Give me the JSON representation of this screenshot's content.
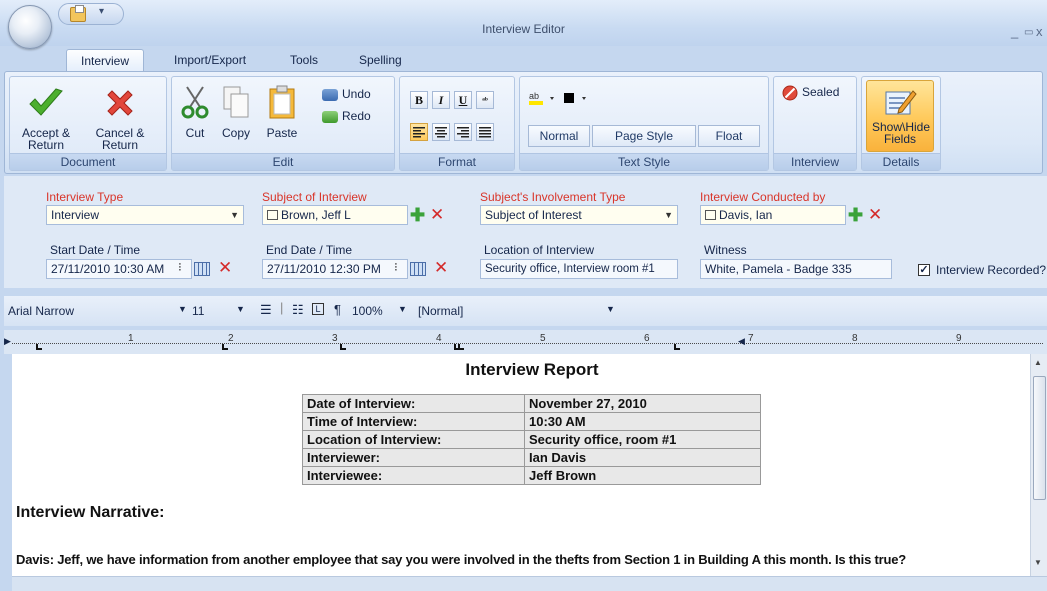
{
  "window": {
    "title": "Interview Editor",
    "min": "_",
    "max": "▭",
    "close": "x",
    "qat_drop": "▾"
  },
  "tabs": [
    {
      "label": "Interview"
    },
    {
      "label": "Import/Export"
    },
    {
      "label": "Tools"
    },
    {
      "label": "Spelling"
    }
  ],
  "ribbon": {
    "document": {
      "label": "Document",
      "accept": "Accept & Return",
      "cancel": "Cancel & Return"
    },
    "edit": {
      "label": "Edit",
      "cut": "Cut",
      "copy": "Copy",
      "paste": "Paste",
      "undo": "Undo",
      "redo": "Redo"
    },
    "format": {
      "label": "Format",
      "bold": "B",
      "italic": "I",
      "underline": "U"
    },
    "text_style": {
      "label": "Text Style",
      "normal": "Normal",
      "page_style": "Page Style",
      "float": "Float"
    },
    "interview": {
      "label": "Interview",
      "sealed": "Sealed"
    },
    "details": {
      "label": "Details",
      "show_hide": "Show\\Hide Fields"
    }
  },
  "fields": {
    "interview_type": {
      "label": "Interview Type",
      "value": "Interview"
    },
    "subject": {
      "label": "Subject of Interview",
      "value": "Brown, Jeff L"
    },
    "involvement": {
      "label": "Subject's Involvement Type",
      "value": "Subject of Interest"
    },
    "conducted_by": {
      "label": "Interview Conducted by",
      "value": "Davis, Ian"
    },
    "start": {
      "label": "Start Date / Time",
      "value": "27/11/2010 10:30 AM"
    },
    "end": {
      "label": "End Date / Time",
      "value": "27/11/2010 12:30 PM"
    },
    "location": {
      "label": "Location of Interview",
      "value": "Security office, Interview room #1"
    },
    "witness": {
      "label": "Witness",
      "value": "White, Pamela - Badge 335"
    },
    "recorded": {
      "label": "Interview Recorded?",
      "checked": true,
      "mark": "✓"
    }
  },
  "editor_toolbar": {
    "font": "Arial Narrow",
    "size": "11",
    "zoom": "100%",
    "style": "[Normal]"
  },
  "ruler": {
    "numbers": [
      "1",
      "2",
      "3",
      "4",
      "5",
      "6",
      "7",
      "8",
      "9"
    ]
  },
  "document": {
    "title": "Interview Report",
    "rows": [
      {
        "k": "Date of Interview:",
        "v": "November 27, 2010"
      },
      {
        "k": "Time of Interview:",
        "v": "10:30 AM"
      },
      {
        "k": "Location of Interview:",
        "v": "Security office, room #1"
      },
      {
        "k": "Interviewer:",
        "v": "Ian Davis"
      },
      {
        "k": "Interviewee:",
        "v": "Jeff Brown"
      }
    ],
    "narrative_heading": "Interview Narrative:",
    "narrative_text": "Davis: Jeff, we have information from another employee that say you were involved in the thefts from Section 1 in Building A this month. Is this true?"
  }
}
